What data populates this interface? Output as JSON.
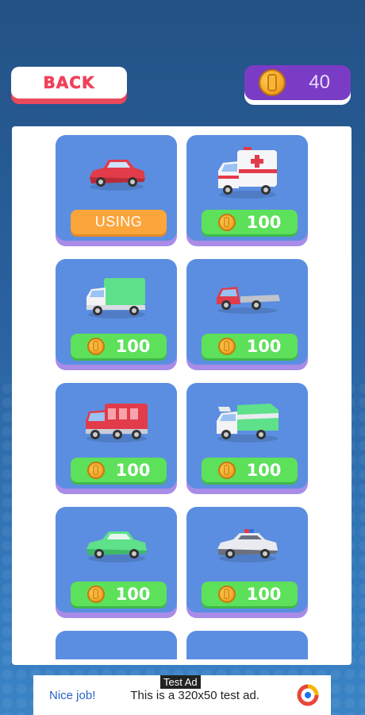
{
  "header": {
    "back_label": "BACK",
    "coin_count": "40"
  },
  "shop": {
    "items": [
      {
        "vehicle": "red-car",
        "state": "using",
        "label": "USING"
      },
      {
        "vehicle": "ambulance",
        "state": "price",
        "price": "100"
      },
      {
        "vehicle": "green-box-truck",
        "state": "price",
        "price": "100"
      },
      {
        "vehicle": "flatbed-tow-truck",
        "state": "price",
        "price": "100"
      },
      {
        "vehicle": "fire-truck",
        "state": "price",
        "price": "100"
      },
      {
        "vehicle": "garbage-truck",
        "state": "price",
        "price": "100"
      },
      {
        "vehicle": "green-sedan",
        "state": "price",
        "price": "100"
      },
      {
        "vehicle": "police-car",
        "state": "price",
        "price": "100"
      }
    ]
  },
  "ad": {
    "tag": "Test Ad",
    "left_text": "Nice job!",
    "body_text": "This is a 320x50 test ad."
  },
  "colors": {
    "card": "#5b8ee0",
    "price_button": "#5de05a",
    "using_button": "#fba53b",
    "back_text": "#f0415a",
    "coin_box": "#7a3cc4"
  }
}
